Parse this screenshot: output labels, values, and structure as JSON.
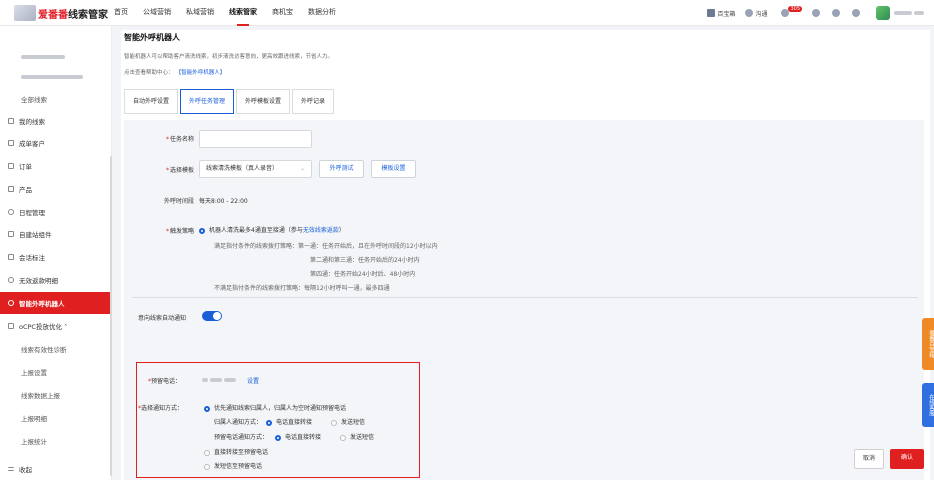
{
  "header": {
    "logo_text": "爱番番",
    "logo_suffix": "线索管家",
    "nav": [
      "首页",
      "公域营销",
      "私域营销",
      "线索管家",
      "商机宝",
      "数据分析"
    ],
    "nav_active_index": 3,
    "right": {
      "baibao": "百宝箱",
      "goutong": "沟通",
      "badge": "305"
    }
  },
  "sidebar": {
    "items": [
      {
        "label": "全部线索",
        "type": "sub"
      },
      {
        "label": "我的线索",
        "type": "main",
        "icon": "list-icon"
      },
      {
        "label": "成单客户",
        "type": "main",
        "icon": "user-icon"
      },
      {
        "label": "订单",
        "type": "main",
        "icon": "order-icon"
      },
      {
        "label": "产品",
        "type": "main",
        "icon": "box-icon"
      },
      {
        "label": "日程管理",
        "type": "main",
        "icon": "calendar-icon"
      },
      {
        "label": "自建站组件",
        "type": "main",
        "icon": "widget-icon"
      },
      {
        "label": "会话标注",
        "type": "main",
        "icon": "pen-icon"
      },
      {
        "label": "无效返款明细",
        "type": "main",
        "icon": "refund-icon"
      },
      {
        "label": "智能外呼机器人",
        "type": "active",
        "icon": "robot-icon"
      },
      {
        "label": "oCPC投放优化 ˄",
        "type": "main",
        "icon": "ocpc-icon"
      },
      {
        "label": "线索有效性诊断",
        "type": "sub"
      },
      {
        "label": "上报设置",
        "type": "sub"
      },
      {
        "label": "线索数据上报",
        "type": "sub"
      },
      {
        "label": "上报明细",
        "type": "sub"
      },
      {
        "label": "上报统计",
        "type": "sub"
      },
      {
        "label": "收起",
        "type": "main",
        "icon": "collapse-icon"
      }
    ]
  },
  "page": {
    "title": "智能外呼机器人",
    "desc": "智能机器人可以帮助客户清洗线索，初步清洗访客意向，更高效跟进线索，节省人力。",
    "help_prefix": "点击查看帮助中心：",
    "help_link": "【智能外呼机器人】",
    "tabs": [
      "自动外呼设置",
      "外呼任务管理",
      "外呼模板设置",
      "外呼记录"
    ],
    "active_tab": 1
  },
  "form": {
    "task_name_label": "任务名称",
    "template_label": "选择模板",
    "template_value": "线索清洗模板（真人录音）",
    "test_btn": "外呼测试",
    "template_settings_btn": "模板设置",
    "time_label": "外呼时间段",
    "time_value": "每天8:00 - 22:00",
    "strategy_label": "触发策略",
    "strategy_main_prefix": "机器人清洗最多4通直至接通（参与",
    "strategy_main_link": "无效线索返款",
    "strategy_main_suffix": "）",
    "strategy_lines": [
      "满足指付条件的线索拨打策略：第一通：任务开始后，且在外呼时间段的12小时以内",
      "第二通和第三通：任务开始后的24小时内",
      "第四通：任务开始24小时后、48小时内",
      "不满足指付条件的线索拨打策略：每隔12小时呼叫一通，最多四通"
    ],
    "notify_label": "意向线索自动通知",
    "reserve_phone_label": "预留电话：",
    "reserve_phone_set": "设置",
    "notify_method_label": "选择通知方式：",
    "opt1": "优先通知线索归属人，归属人为空时通知预留电话",
    "owner_method_label": "归属人通知方式：",
    "owner_direct": "电话直接转接",
    "owner_sms": "发送短信",
    "reserve_method_label": "预留电话通知方式：",
    "reserve_direct": "电话直接转接",
    "reserve_sms": "发送短信",
    "opt2": "直接转接至预留电话",
    "opt3": "发短信至预留电话",
    "cancel": "取消",
    "confirm": "确认"
  },
  "float": {
    "top": "番番百宝箱",
    "bottom": "在线客服"
  }
}
